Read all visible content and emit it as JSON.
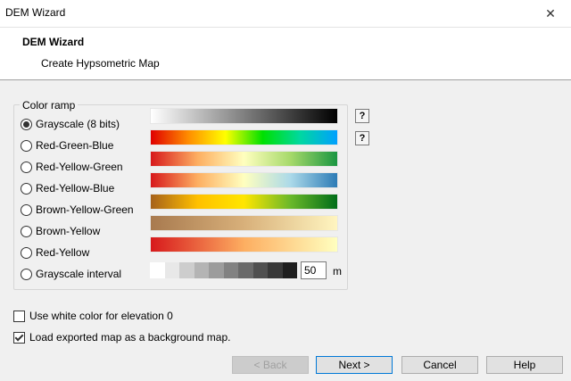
{
  "window": {
    "title": "DEM Wizard",
    "close_glyph": "✕"
  },
  "header": {
    "title": "DEM Wizard",
    "subtitle": "Create Hypsometric Map"
  },
  "color_ramp": {
    "legend": "Color ramp",
    "help_glyph": "?",
    "options": [
      {
        "label": "Grayscale (8 bits)",
        "checked": true
      },
      {
        "label": "Red-Green-Blue",
        "checked": false
      },
      {
        "label": "Red-Yellow-Green",
        "checked": false
      },
      {
        "label": "Red-Yellow-Blue",
        "checked": false
      },
      {
        "label": "Brown-Yellow-Green",
        "checked": false
      },
      {
        "label": "Brown-Yellow",
        "checked": false
      },
      {
        "label": "Red-Yellow",
        "checked": false
      },
      {
        "label": "Grayscale interval",
        "checked": false
      }
    ],
    "interval_value": "50",
    "interval_unit": "m",
    "interval_colors": [
      "#ffffff",
      "#e8e8e8",
      "#cdcdcd",
      "#b4b4b4",
      "#9c9c9c",
      "#828282",
      "#6a6a6a",
      "#505050",
      "#383838",
      "#1e1e1e"
    ]
  },
  "options": {
    "white_zero_label": "Use white color for elevation 0",
    "white_zero_checked": false,
    "background_label": "Load exported map as a background map.",
    "background_checked": true
  },
  "buttons": {
    "back": "< Back",
    "next": "Next >",
    "cancel": "Cancel",
    "help": "Help"
  }
}
